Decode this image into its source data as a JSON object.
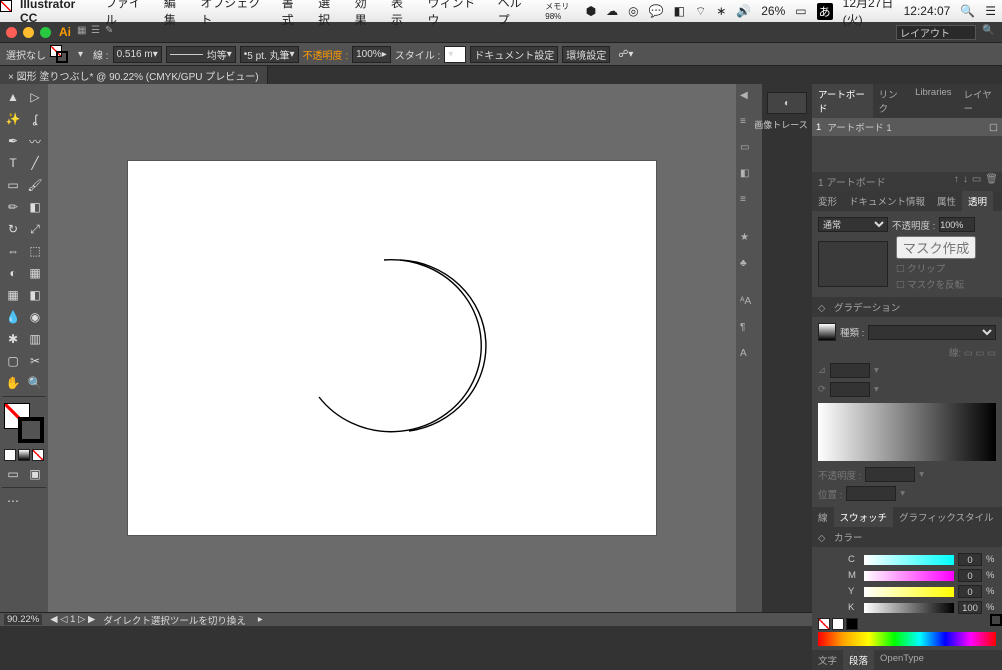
{
  "menubar": {
    "app": "Illustrator CC",
    "items": [
      "ファイル",
      "編集",
      "オブジェクト",
      "書式",
      "選択",
      "効果",
      "表示",
      "ウィンドウ",
      "ヘルプ"
    ],
    "right": {
      "memory": "メモリ 98%",
      "date": "12月27日(火)",
      "time": "12:24:07",
      "battery": "26%",
      "input": "あ"
    }
  },
  "titlebar": {
    "layout_label": "レイアウト"
  },
  "control": {
    "selection": "選択なし",
    "stroke_label": "線 :",
    "stroke_width": "0.516 m",
    "stroke_style": "均等",
    "brush": "5 pt. 丸筆",
    "opacity_label": "不透明度 :",
    "opacity_val": "100%",
    "style_label": "スタイル :",
    "doc_setup": "ドキュメント設定",
    "env_setup": "環境設定"
  },
  "doc_tab": "図形 塗りつぶし* @ 90.22% (CMYK/GPU プレビュー)",
  "image_trace": "画像トレース",
  "panels": {
    "tabs1": [
      "アートボード",
      "リンク",
      "Libraries",
      "レイヤー"
    ],
    "artboard_num": "1",
    "artboard_name": "アートボード 1",
    "count_label": "1 アートボード",
    "tabs2": [
      "変形",
      "ドキュメント情報",
      "属性",
      "透明"
    ],
    "blend": "通常",
    "opacity_label": "不透明度 :",
    "opacity_val": "100%",
    "mask_make": "マスク作成",
    "clip": "クリップ",
    "mask_invert": "マスクを反転",
    "grad_title": "グラデーション",
    "grad_type_label": "種類 :",
    "grad_angle": "",
    "grad_opacity_label": "不透明度 :",
    "grad_pos_label": "位置 :",
    "tabs3": [
      "線",
      "スウォッチ",
      "グラフィックスタイル"
    ],
    "color_title": "カラー",
    "cmyk": {
      "c": {
        "label": "C",
        "val": "0"
      },
      "m": {
        "label": "M",
        "val": "0"
      },
      "y": {
        "label": "Y",
        "val": "0"
      },
      "k": {
        "label": "K",
        "val": "100"
      }
    },
    "tabs4": [
      "文字",
      "段落",
      "OpenType"
    ]
  },
  "status": {
    "zoom": "90.22%",
    "msg": "ダイレクト選択ツールを切り換え"
  },
  "chart_data": null
}
